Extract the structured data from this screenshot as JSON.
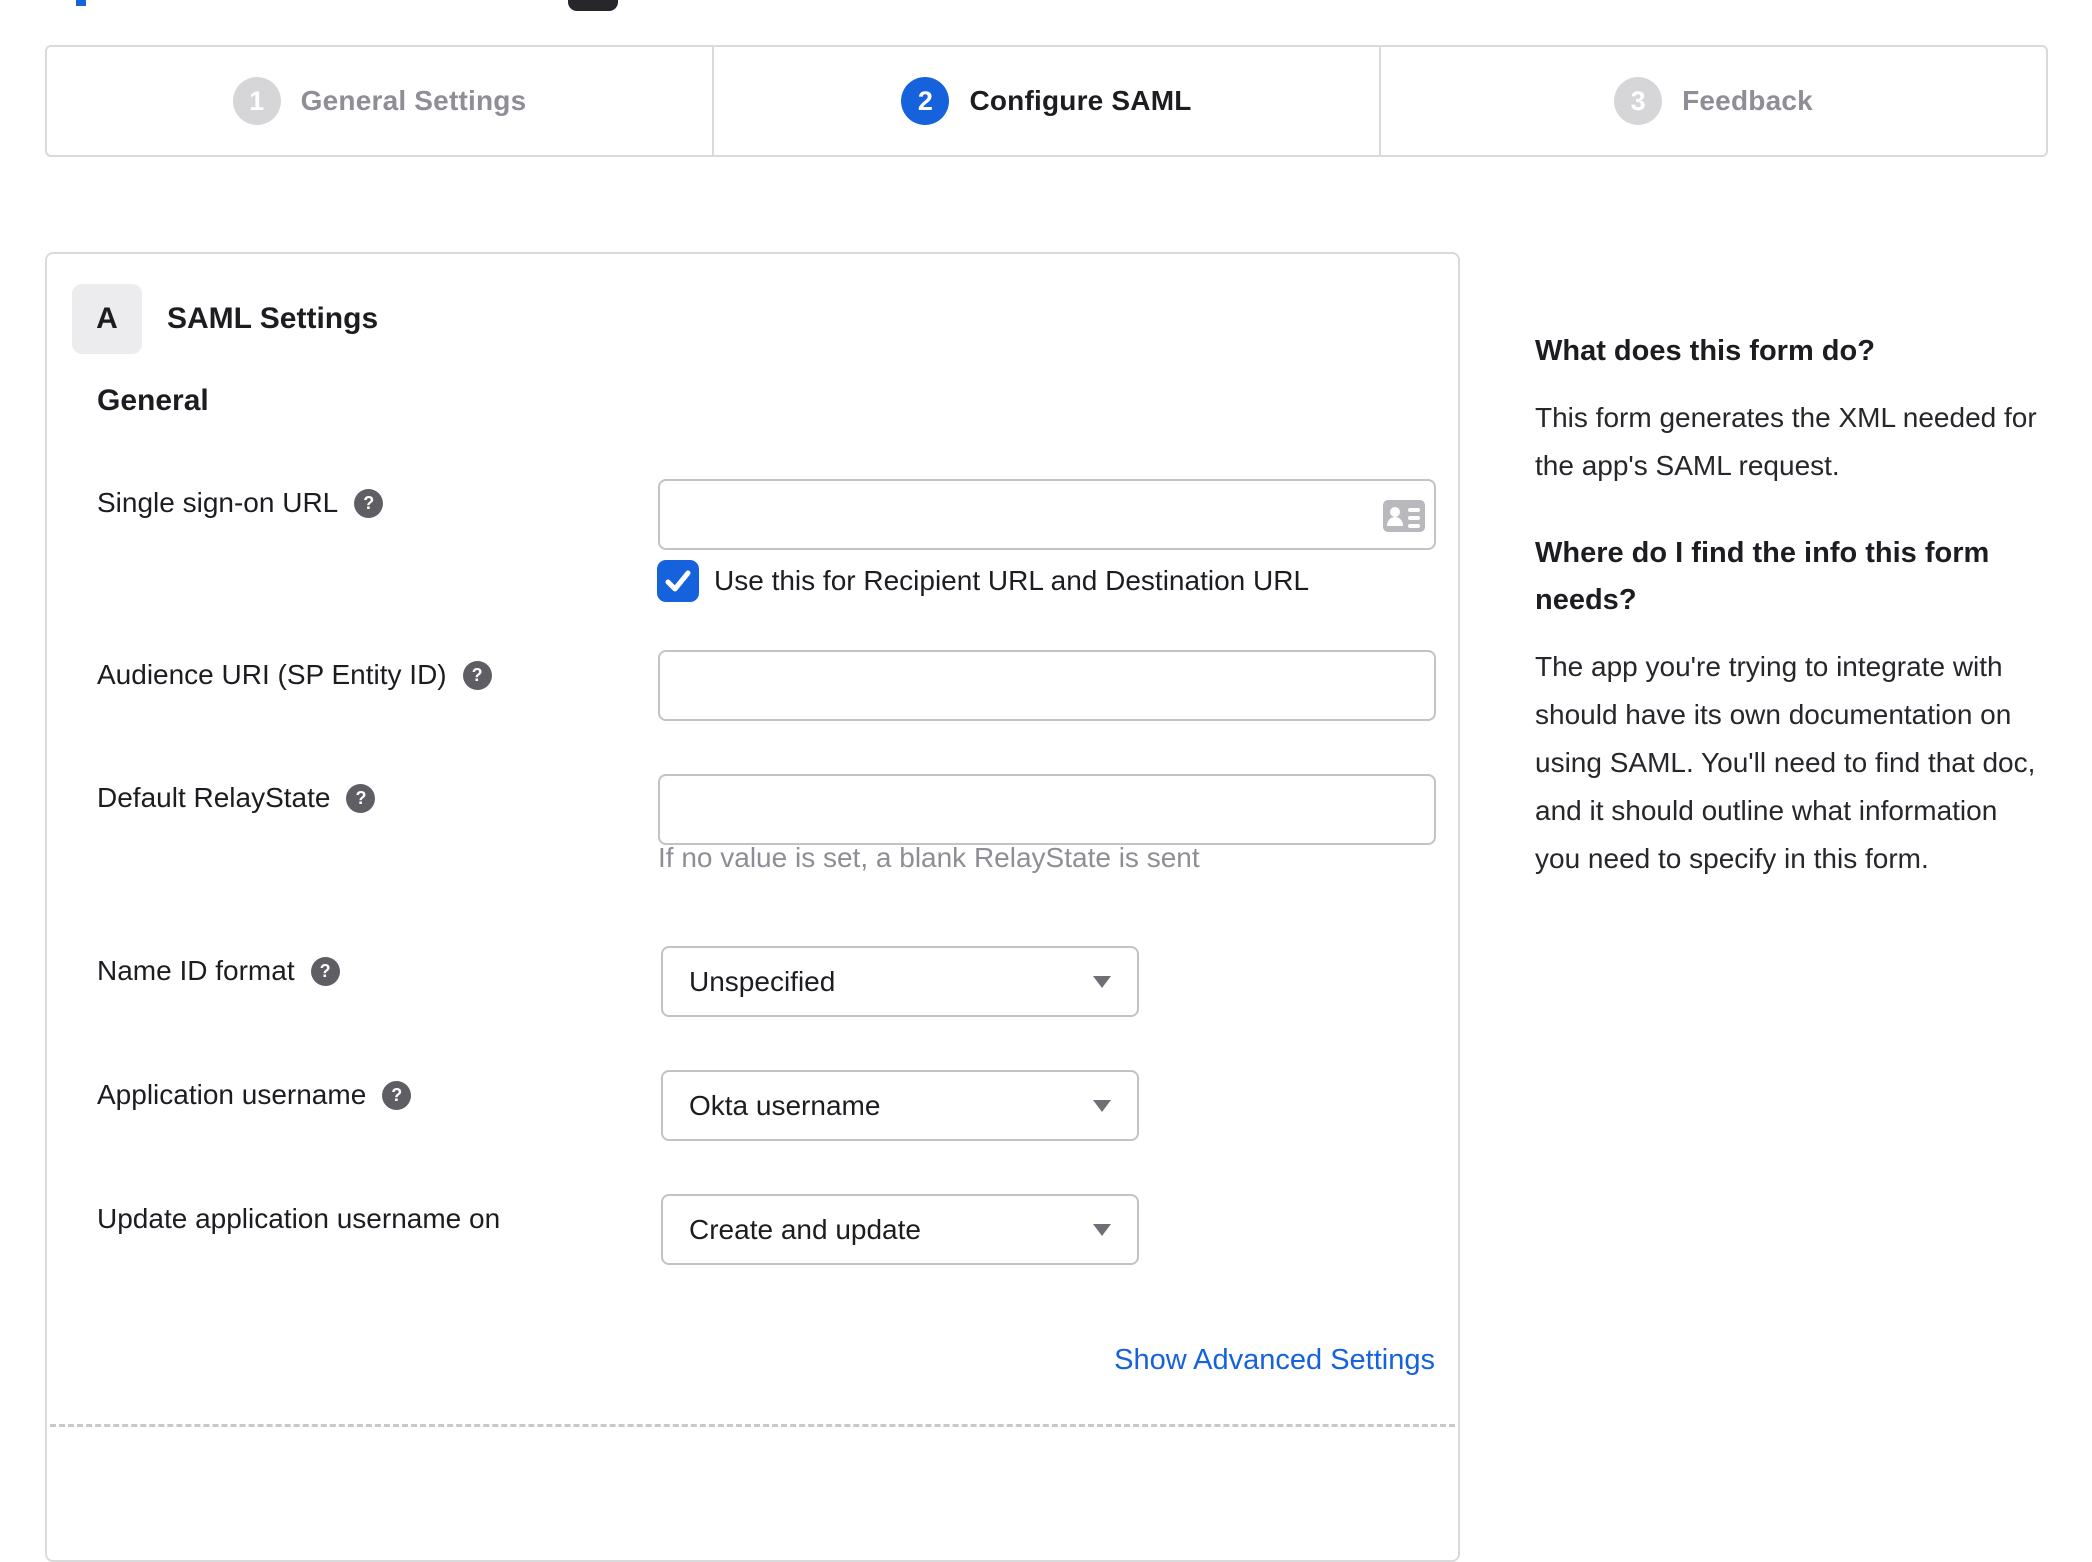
{
  "stepper": {
    "steps": [
      {
        "number": "1",
        "label": "General Settings",
        "state": "inactive"
      },
      {
        "number": "2",
        "label": "Configure SAML",
        "state": "active"
      },
      {
        "number": "3",
        "label": "Feedback",
        "state": "inactive"
      }
    ]
  },
  "panel": {
    "section_badge": "A",
    "section_title": "SAML Settings",
    "subsection_title": "General",
    "advanced_link_label": "Show Advanced Settings"
  },
  "form": {
    "sso_url": {
      "label": "Single sign-on URL",
      "value": "",
      "has_help": true
    },
    "recipient_checkbox": {
      "label": "Use this for Recipient URL and Destination URL",
      "checked": true
    },
    "audience_uri": {
      "label": "Audience URI (SP Entity ID)",
      "value": "",
      "has_help": true
    },
    "relay_state": {
      "label": "Default RelayState",
      "value": "",
      "has_help": true,
      "hint": "If no value is set, a blank RelayState is sent"
    },
    "name_id_format": {
      "label": "Name ID format",
      "value": "Unspecified",
      "has_help": true
    },
    "app_username": {
      "label": "Application username",
      "value": "Okta username",
      "has_help": true
    },
    "update_app_username": {
      "label": "Update application username on",
      "value": "Create and update",
      "has_help": false
    }
  },
  "icons": {
    "help_glyph": "?"
  },
  "sidebar": {
    "heading1": "What does this form do?",
    "para1": "This form generates the XML needed for the app's SAML request.",
    "heading2": "Where do I find the info this form needs?",
    "para2": "The app you're trying to integrate with should have its own documentation on using SAML. You'll need to find that doc, and it should outline what information you need to specify in this form."
  },
  "colors": {
    "accent_blue": "#1662dd",
    "text_dark": "#1d1d21",
    "text_gray": "#8e8e96",
    "panel_border": "#dadadd",
    "input_border": "#c3c3c7",
    "help_icon_bg": "#5e5e64"
  }
}
